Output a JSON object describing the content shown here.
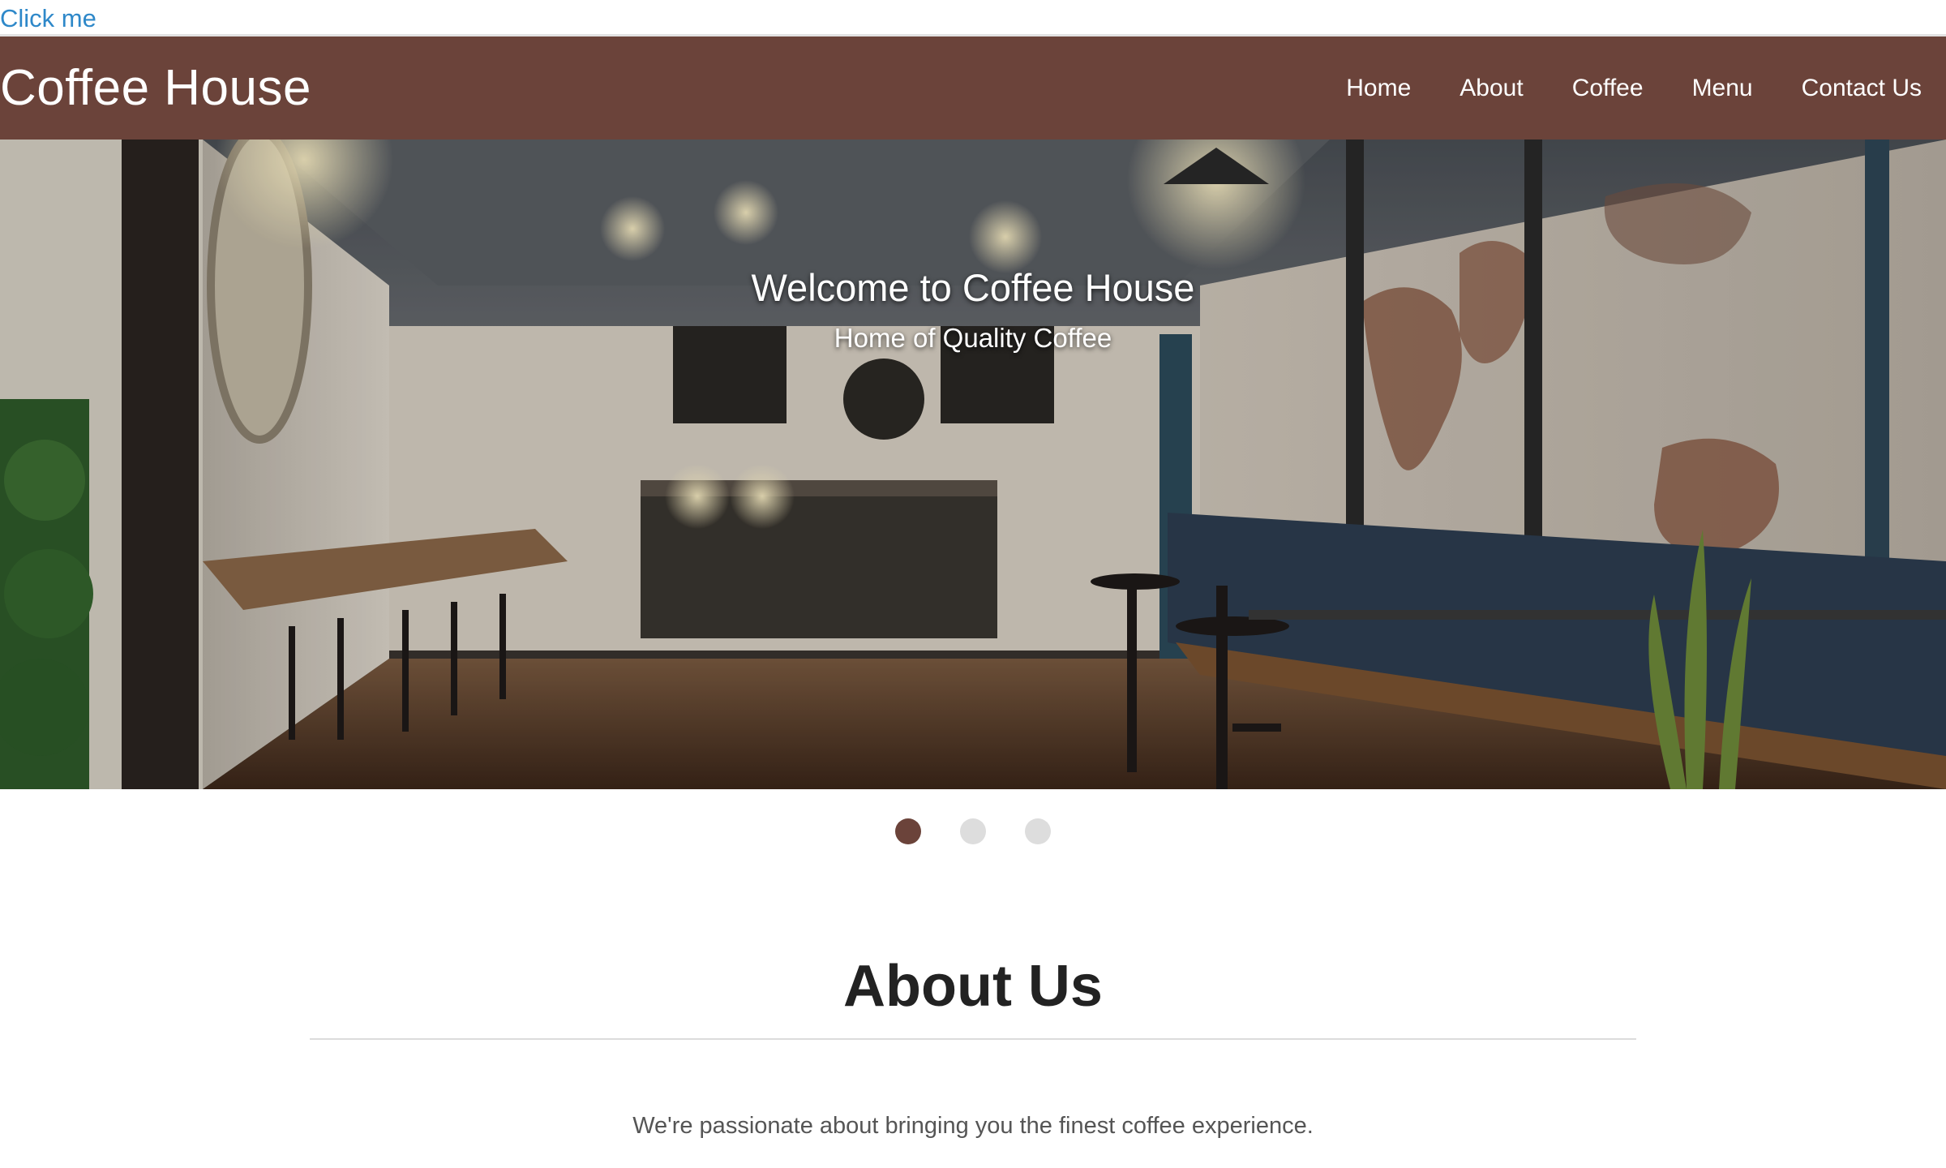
{
  "skip_link": {
    "label": "Click me"
  },
  "navbar": {
    "brand": "Coffee House",
    "links": [
      {
        "label": "Home"
      },
      {
        "label": "About"
      },
      {
        "label": "Coffee"
      },
      {
        "label": "Menu"
      },
      {
        "label": "Contact Us"
      }
    ],
    "color": "#6b433a"
  },
  "hero": {
    "title": "Welcome to Coffee House",
    "subtitle": "Home of Quality Coffee",
    "slide_count": 3,
    "active_slide": 1
  },
  "about": {
    "title": "About Us",
    "text": "We're passionate about bringing you the finest coffee experience."
  },
  "colors": {
    "accent": "#6b433a",
    "link": "#2e88c9",
    "inactive_dot": "#dddddd"
  }
}
